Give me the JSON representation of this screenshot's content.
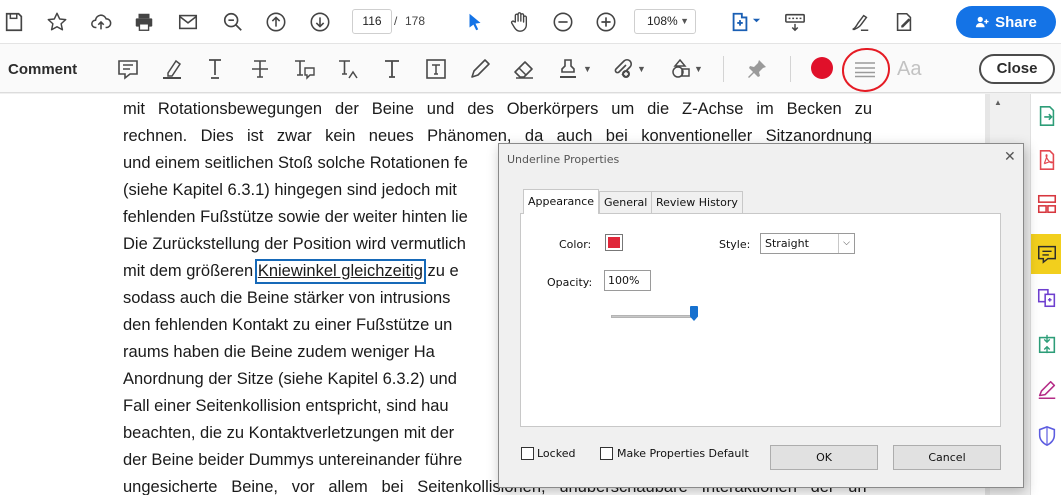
{
  "toolbar": {
    "page_current": "116",
    "page_separator": "/",
    "page_total": "178",
    "zoom": "108%",
    "share_label": "Share"
  },
  "comment_toolbar": {
    "title": "Comment",
    "font_label": "Aa",
    "close_label": "Close",
    "active_color": "#e0102a"
  },
  "document": {
    "lines": [
      "mit Rotationsbewegungen der Beine und des Oberkörpers um die Z-Achse im Becken zu",
      "rechnen. Dies ist zwar kein neues Phänomen, da auch bei konventioneller Sitzanordnung",
      "und einem seitlichen Stoß solche Rotationen fe",
      "(siehe Kapitel 6.3.1) hingegen sind jedoch mit",
      "fehlenden Fußstütze sowie der weiter hinten lie",
      "Die Zurückstellung der Position wird vermutlich",
      "mit dem größeren",
      "sodass auch die Beine stärker von intrusions",
      "den fehlenden Kontakt zu einer Fußstütze un",
      "raums haben die Beine zudem weniger Ha",
      "Anordnung der Sitze (siehe Kapitel 6.3.2) und",
      "Fall einer Seitenkollision entspricht, sind hau",
      "beachten, die zu Kontaktverletzungen mit der",
      "der Beine beider Dummys untereinander führe",
      "ungesicherte Beine, vor allem bei Seitenkollisionen, unüberschaubare Interaktionen der un-"
    ],
    "highlighted": "Kniewinkel gleichzeitig",
    "after_highlight": "zu e"
  },
  "dialog": {
    "title": "Underline Properties",
    "tabs": [
      "Appearance",
      "General",
      "Review History"
    ],
    "color_label": "Color:",
    "color_value": "#e0273a",
    "style_label": "Style:",
    "style_value": "Straight",
    "opacity_label": "Opacity:",
    "opacity_value": "100%",
    "opacity_level": 1.0,
    "locked_label": "Locked",
    "make_default_label": "Make Properties Default",
    "ok_label": "OK",
    "cancel_label": "Cancel"
  },
  "icons": {
    "top": [
      "save-icon",
      "star-icon",
      "upload-icon",
      "print-icon",
      "email-icon",
      "zoom-search-icon",
      "page-up-icon",
      "page-down-icon",
      "select-arrow-icon",
      "hand-icon",
      "zoom-out-icon",
      "zoom-in-icon",
      "fit-page-icon",
      "keyboard-scroll-icon",
      "sign-icon",
      "fill-edit-icon"
    ],
    "comment": [
      "sticky-note-icon",
      "highlight-icon",
      "underline-text-icon",
      "strikethrough-icon",
      "replace-text-icon",
      "insert-text-icon",
      "add-text-icon",
      "text-box-icon",
      "draw-pencil-icon",
      "eraser-icon",
      "stamp-icon",
      "attach-icon",
      "shapes-icon",
      "pin-icon",
      "line-style-icon"
    ],
    "rail": [
      "export-pdf-icon",
      "create-pdf-icon",
      "organize-pages-icon",
      "comment-icon",
      "combine-files-icon",
      "compress-icon",
      "fill-sign-icon",
      "protect-icon"
    ]
  }
}
